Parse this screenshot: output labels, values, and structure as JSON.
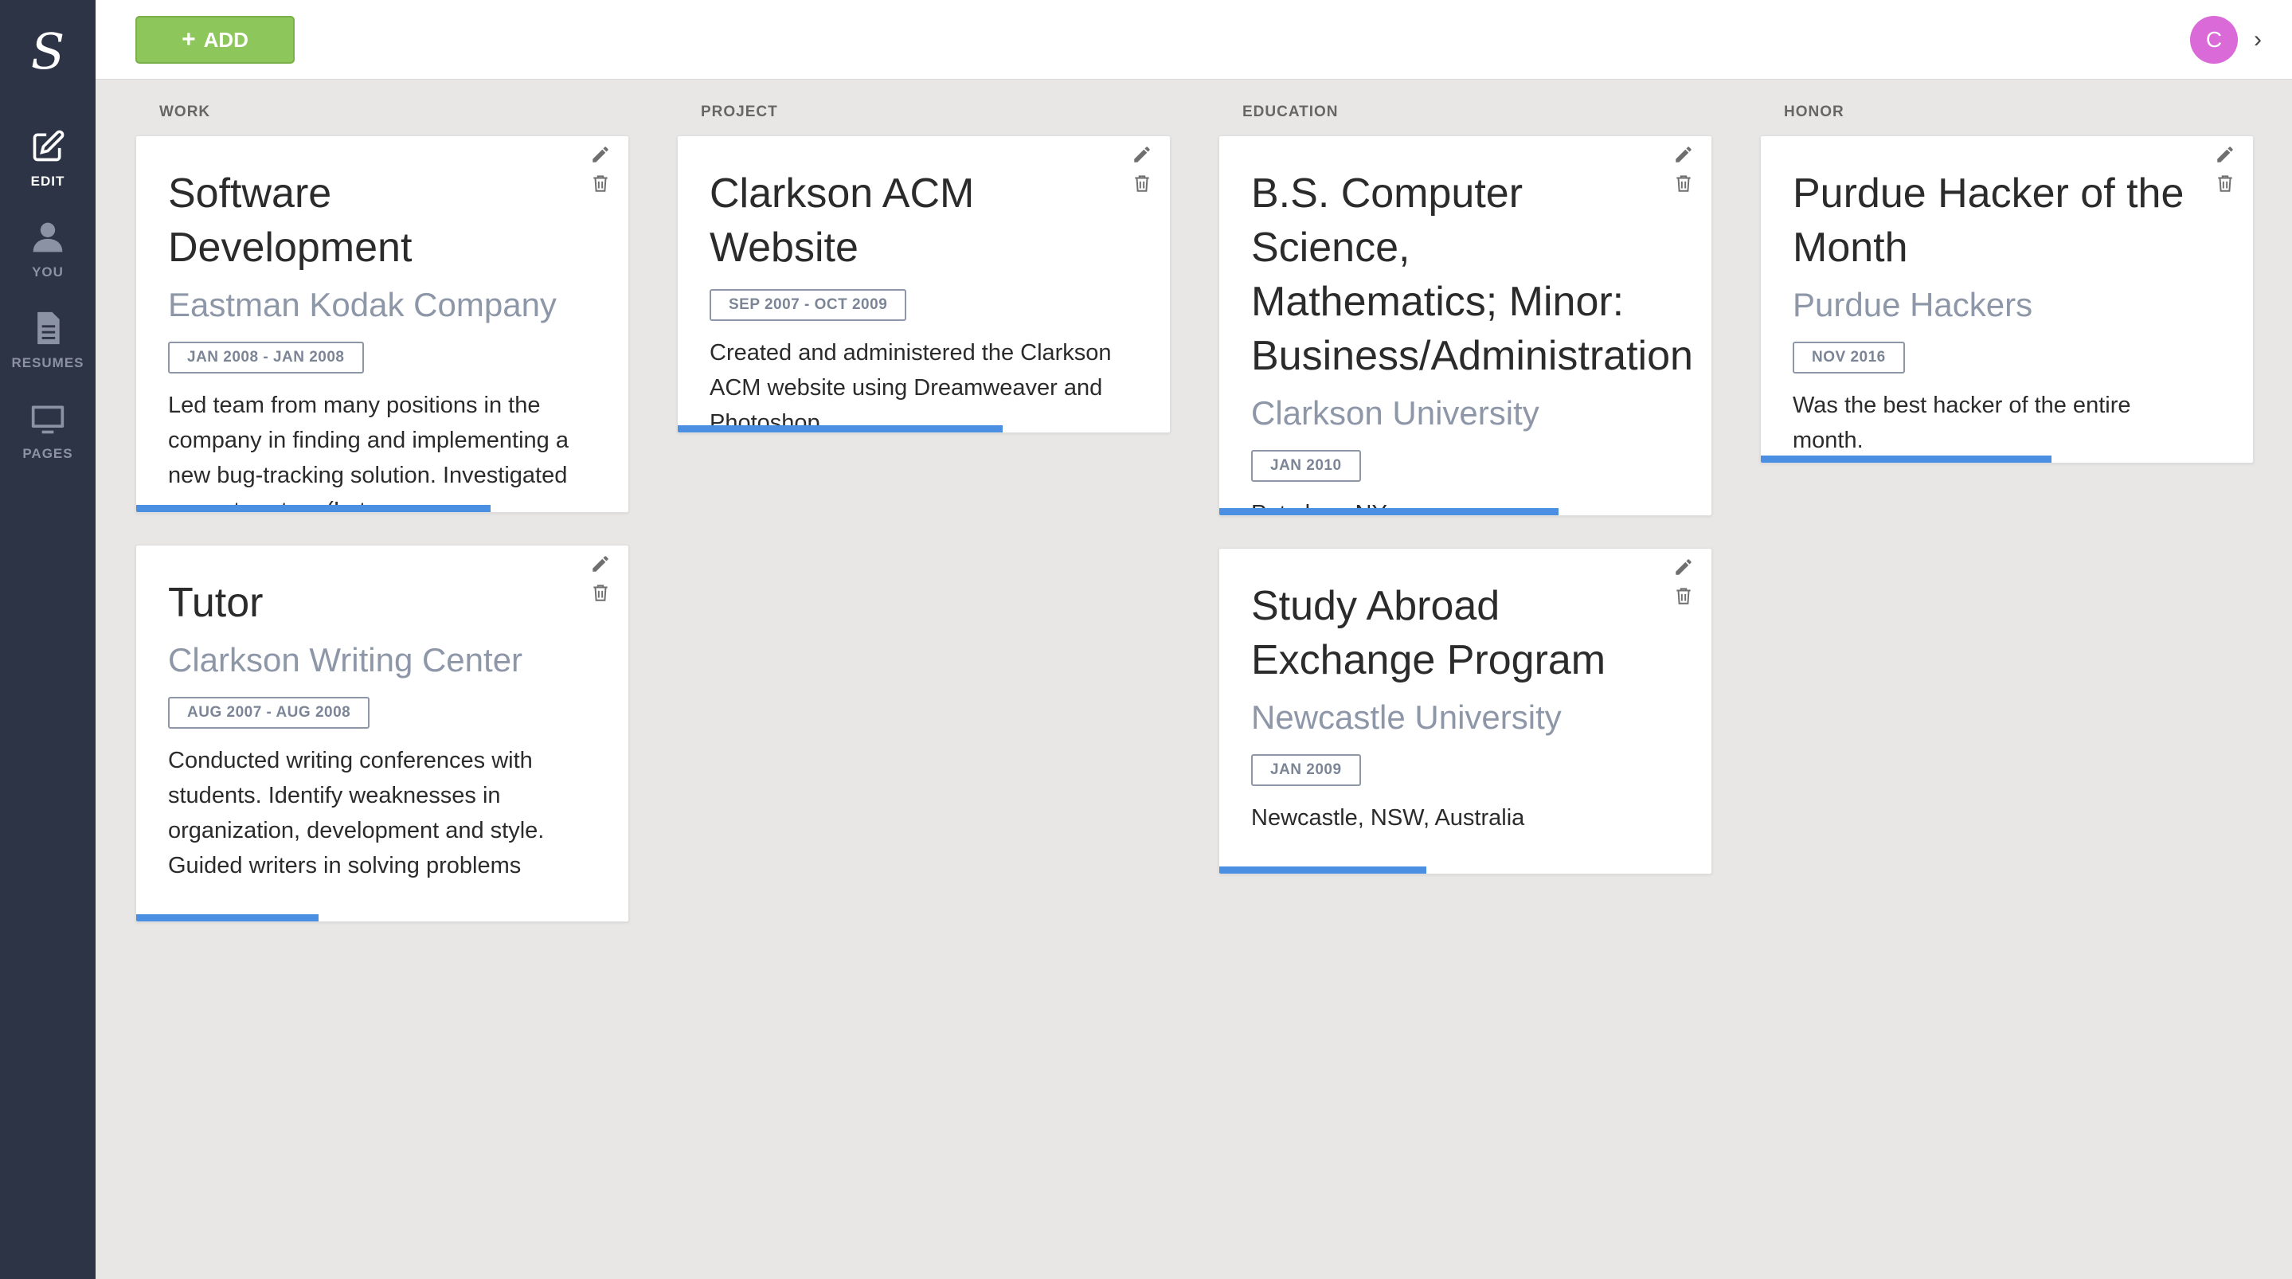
{
  "app": {
    "logo": "S"
  },
  "sidebar": {
    "items": [
      {
        "label": "EDIT",
        "icon": "edit-icon",
        "active": true
      },
      {
        "label": "YOU",
        "icon": "user-icon",
        "active": false
      },
      {
        "label": "RESUMES",
        "icon": "document-icon",
        "active": false
      },
      {
        "label": "PAGES",
        "icon": "monitor-icon",
        "active": false
      }
    ]
  },
  "toolbar": {
    "add_label": "ADD",
    "add_icon": "plus-icon",
    "avatar_initial": "C",
    "avatar_color": "#d96ad8",
    "menu_icon": "chevron-right-icon"
  },
  "colors": {
    "sidebar_bg": "#2d3446",
    "add_button": "#8dc75b",
    "progress": "#4a8fe2",
    "subtitle": "#8d97a8",
    "page_bg": "#e8e7e5"
  },
  "columns": [
    {
      "header": "WORK",
      "cards": [
        {
          "title": "Software Development",
          "subtitle": "Eastman Kodak Company",
          "date": "JAN 2008 - JAN 2008",
          "description": "Led team from many positions in the company in finding and implementing a new bug-tracking solution. Investigated current system (Lotus…",
          "progress": 0.72
        },
        {
          "title": "Tutor",
          "subtitle": "Clarkson Writing Center",
          "date": "AUG 2007 - AUG 2008",
          "description": "Conducted writing conferences with students. Identify weaknesses in organization, development and style. Guided writers in solving problems",
          "progress": 0.37
        }
      ]
    },
    {
      "header": "PROJECT",
      "cards": [
        {
          "title": "Clarkson ACM Website",
          "subtitle": "",
          "date": "SEP 2007 - OCT 2009",
          "description": "Created and administered the Clarkson ACM website using Dreamweaver and Photoshop.",
          "progress": 0.66
        }
      ]
    },
    {
      "header": "EDUCATION",
      "cards": [
        {
          "title": "B.S. Computer Science, Mathematics; Minor: Business/Administration",
          "subtitle": "Clarkson University",
          "date": "JAN 2010",
          "description": "Potsdam, NY",
          "progress": 0.69
        },
        {
          "title": "Study Abroad Exchange Program",
          "subtitle": "Newcastle University",
          "date": "JAN 2009",
          "description": "Newcastle, NSW, Australia",
          "progress": 0.42
        }
      ]
    },
    {
      "header": "HONOR",
      "cards": [
        {
          "title": "Purdue Hacker of the Month",
          "subtitle": "Purdue Hackers",
          "date": "NOV 2016",
          "description": "Was the best hacker of the entire month.",
          "progress": 0.59
        }
      ]
    }
  ],
  "card_actions": {
    "edit_icon": "pencil-icon",
    "delete_icon": "trash-icon"
  }
}
